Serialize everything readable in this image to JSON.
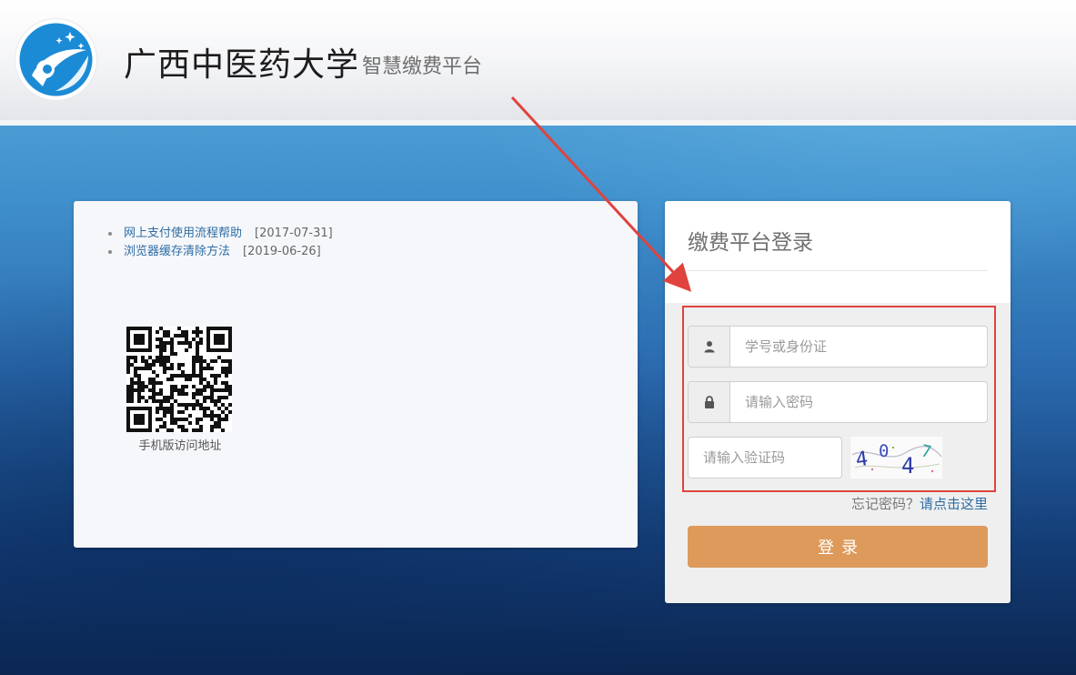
{
  "header": {
    "title": "广西中医药大学",
    "subtitle": "智慧缴费平台"
  },
  "notices": [
    {
      "label": "网上支付使用流程帮助",
      "date": "[2017-07-31]"
    },
    {
      "label": "浏览器缓存清除方法",
      "date": "[2019-06-26]"
    }
  ],
  "qr": {
    "label": "手机版访问地址"
  },
  "login": {
    "title": "缴费平台登录",
    "username_placeholder": "学号或身份证",
    "password_placeholder": "请输入密码",
    "captcha_placeholder": "请输入验证码",
    "captcha_chars": [
      "4",
      "0",
      "4",
      "7"
    ],
    "forgot_text": "忘记密码？",
    "forgot_link": "请点击这里",
    "submit_label": "登录"
  },
  "colors": {
    "accent_button": "#dd9a5b",
    "link": "#2e6da4",
    "annotation_red": "#e0433d"
  },
  "icons": {
    "username": "user-icon",
    "password": "lock-icon",
    "logo": "university-logo"
  }
}
